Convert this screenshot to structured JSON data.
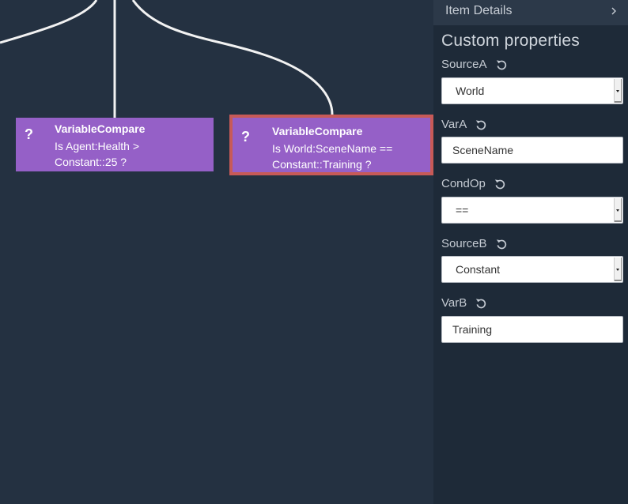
{
  "graph": {
    "nodes": [
      {
        "icon": "?",
        "title": "VariableCompare",
        "description": "Is Agent:Health > Constant::25 ?",
        "selected": false
      },
      {
        "icon": "?",
        "title": "VariableCompare",
        "description": "Is World:SceneName == Constant::Training ?",
        "selected": true
      }
    ]
  },
  "panel": {
    "header": "Item Details",
    "title": "Custom properties",
    "properties": [
      {
        "label": "SourceA",
        "type": "select",
        "value": "World"
      },
      {
        "label": "VarA",
        "type": "text",
        "value": "SceneName"
      },
      {
        "label": "CondOp",
        "type": "select",
        "value": "=="
      },
      {
        "label": "SourceB",
        "type": "select",
        "value": "Constant"
      },
      {
        "label": "VarB",
        "type": "text",
        "value": "Training"
      }
    ]
  },
  "colors": {
    "canvas_bg": "#243141",
    "node_fill": "#9560c7",
    "selected_border": "#c75a57",
    "connector": "#f2f2f2",
    "panel_bg": "#1e2a38"
  },
  "icons": {
    "header_chevron": "chevron-right-icon",
    "reset": "reset-icon"
  }
}
